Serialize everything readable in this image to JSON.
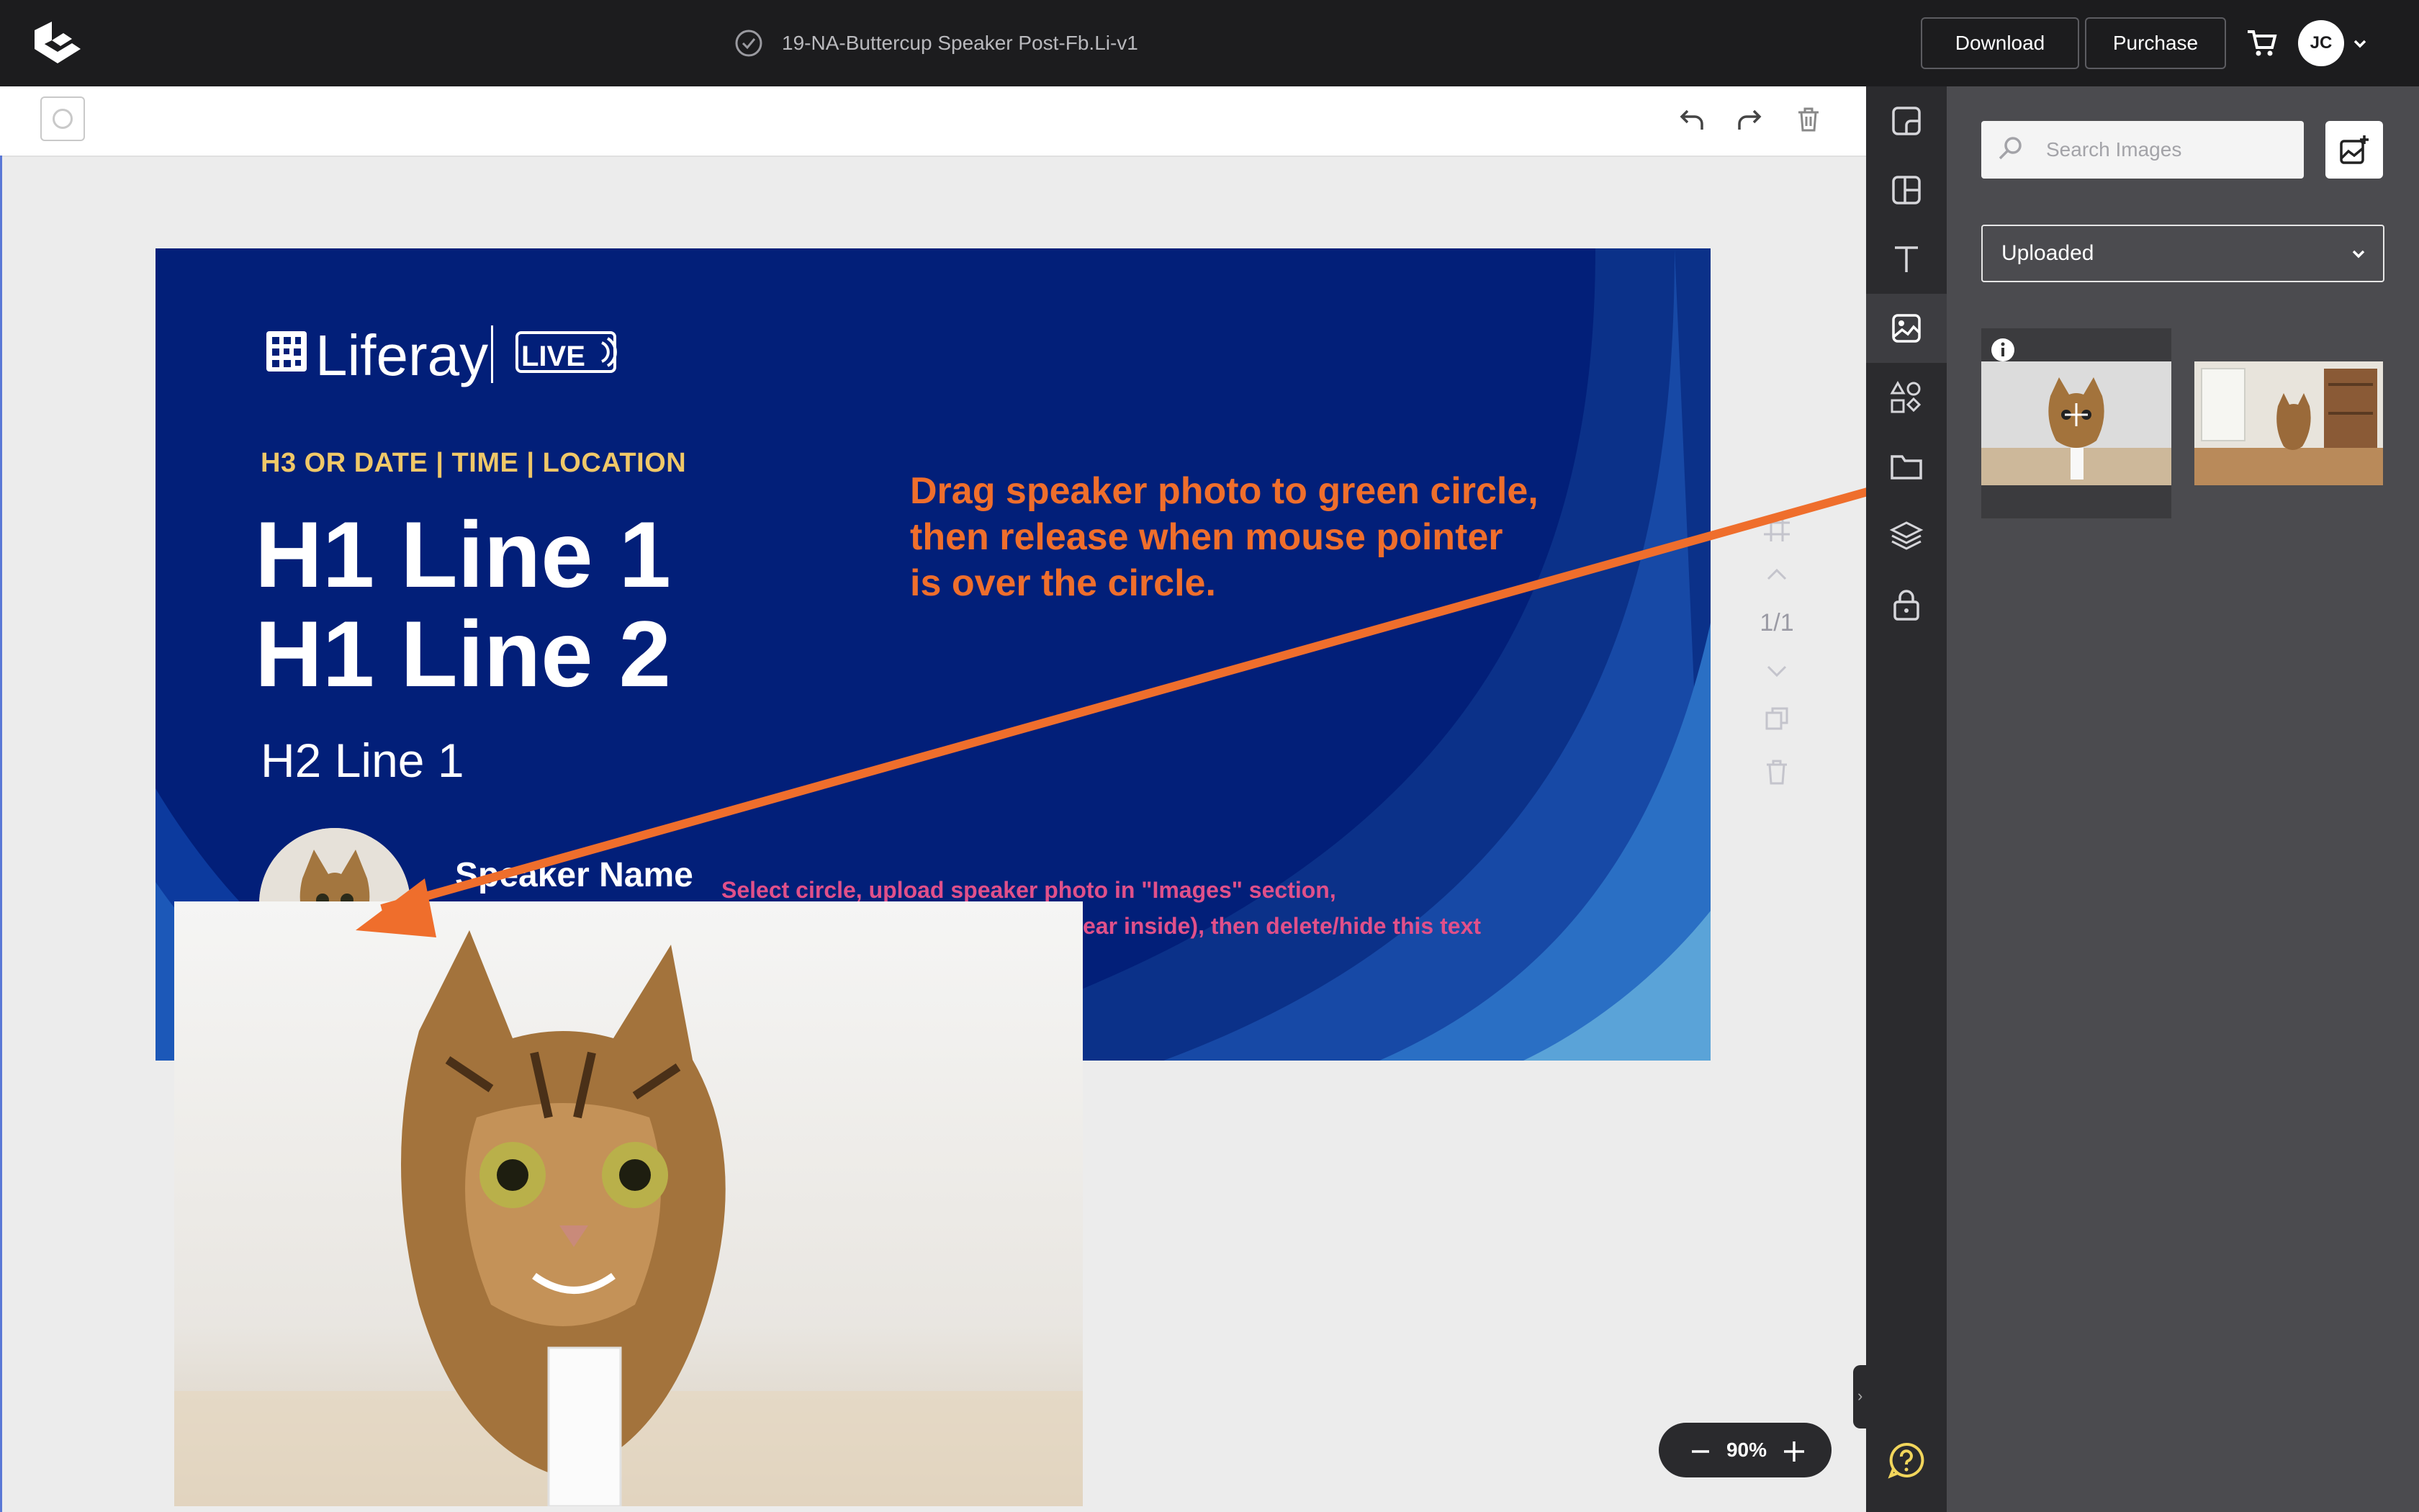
{
  "header": {
    "doc_title": "19-NA-Buttercup Speaker Post-Fb.Li-v1",
    "download_label": "Download",
    "purchase_label": "Purchase",
    "avatar_initials": "JC",
    "logo_icon": "app-logo-icon",
    "status_icon": "check-circle-icon",
    "cart_icon": "cart-icon"
  },
  "toolbar": {
    "undo_icon": "undo-icon",
    "redo_icon": "redo-icon",
    "delete_icon": "trash-icon"
  },
  "slide": {
    "brand": "Liferay",
    "brand_badge": "LIVE",
    "h3": "H3 OR DATE | TIME | LOCATION",
    "h1_line1": "H1 Line 1",
    "h1_line2": "H1 Line 2",
    "h2_line1": "H2 Line 1",
    "speaker_name": "Speaker Name",
    "hint_line1": "Select circle, upload speaker photo in \"Images\" section,",
    "hint_line2": "ear inside), then delete/hide this text",
    "background_color": "#021f79",
    "accent_color": "#f0c868"
  },
  "annotation": {
    "line1": "Drag speaker photo to green circle,",
    "line2": "then release when mouse pointer",
    "line3": "is over the circle.",
    "color": "#ef6e2c"
  },
  "page_controls": {
    "page_count": "1/1"
  },
  "zoom": {
    "value": "90%"
  },
  "nav": {
    "items": [
      {
        "name": "templates-icon"
      },
      {
        "name": "layout-icon"
      },
      {
        "name": "text-icon"
      },
      {
        "name": "images-icon",
        "active": true
      },
      {
        "name": "shapes-icon"
      },
      {
        "name": "folder-icon"
      },
      {
        "name": "layers-icon"
      },
      {
        "name": "lock-icon"
      }
    ],
    "help_icon": "help-icon"
  },
  "panel": {
    "search_placeholder": "Search Images",
    "dropdown_value": "Uploaded"
  }
}
